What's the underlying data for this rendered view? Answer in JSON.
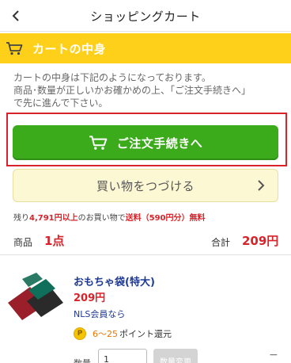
{
  "header": {
    "title": "ショッピングカート"
  },
  "section": {
    "label": "カートの中身"
  },
  "notice": {
    "line1": "カートの中身は下記のようになっております。",
    "line2": "商品･数量が正しいかお確かめの上、「ご注文手続きへ」",
    "line3": "で先に進んで下さい。"
  },
  "buttons": {
    "order": "ご注文手続きへ",
    "continue": "買い物をつづける"
  },
  "free_shipping": {
    "prefix": "残り",
    "amount": "4,791円以上",
    "middle": "のお買い物で",
    "shipping": "送料（590円分）無料"
  },
  "summary": {
    "qty_label": "商品",
    "qty_value": "1点",
    "total_label": "合計",
    "total_value": "209円"
  },
  "item": {
    "name": "おもちゃ袋(特大)",
    "price": "209円",
    "member": "NLS会員なら",
    "coin_letter": "P",
    "points_range": "6〜25",
    "points_text": "ポイント還元",
    "qty_label": "数量",
    "qty_value": "1",
    "update_label": "数量変更",
    "remove_label": "−"
  },
  "colors": {
    "section_bar": "#ffd01a",
    "order_button": "#3bab1c",
    "highlight_frame": "#d8232a",
    "price_red": "#d8232a",
    "link_blue": "#1f3a93",
    "continue_button": "#fdf8d4"
  },
  "icons": {
    "back": "chevron-left-icon",
    "section": "cart-icon",
    "order": "cart-icon",
    "continue": "chevron-right-icon",
    "points": "point-coin-icon"
  }
}
